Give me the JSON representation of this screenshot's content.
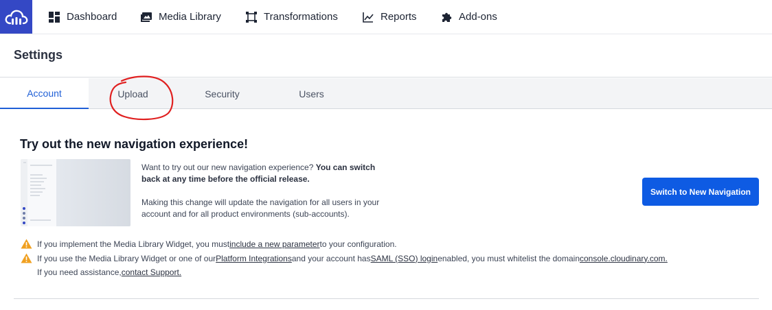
{
  "nav": {
    "items": [
      {
        "label": "Dashboard",
        "icon": "dashboard-icon"
      },
      {
        "label": "Media Library",
        "icon": "media-library-icon"
      },
      {
        "label": "Transformations",
        "icon": "transformations-icon"
      },
      {
        "label": "Reports",
        "icon": "reports-icon"
      },
      {
        "label": "Add-ons",
        "icon": "puzzle-icon"
      }
    ]
  },
  "page": {
    "title": "Settings"
  },
  "tabs": [
    {
      "label": "Account",
      "active": true
    },
    {
      "label": "Upload",
      "active": false
    },
    {
      "label": "Security",
      "active": false
    },
    {
      "label": "Users",
      "active": false
    }
  ],
  "promo": {
    "title": "Try out the new navigation experience!",
    "para1_plain": "Want to try out our new navigation experience? ",
    "para1_bold": "You can switch back at any time before the official release.",
    "para2": "Making this change will update the navigation for all users in your account and for all product environments (sub-accounts).",
    "button_label": "Switch to New Navigation"
  },
  "notices": {
    "n1_pre": "If you implement the Media Library Widget, you must ",
    "n1_link": "include a new parameter",
    "n1_post": " to your configuration.",
    "n2_pre": "If you use the Media Library Widget or one of our ",
    "n2_link1": "Platform Integrations",
    "n2_mid": " and your account has ",
    "n2_link2": "SAML (SSO) login",
    "n2_mid2": " enabled, you must whitelist the domain ",
    "n2_link3": "console.cloudinary.com.",
    "n3_pre": "If you need assistance, ",
    "n3_link": "contact Support."
  },
  "colors": {
    "brand": "#3448c5",
    "primary_button": "#0e5be3",
    "active_tab": "#1f5fd6",
    "warning": "#f0a020",
    "annotation": "#e02020"
  }
}
